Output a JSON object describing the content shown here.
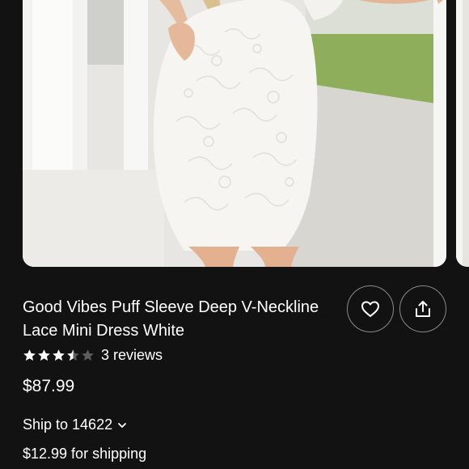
{
  "product": {
    "title": "Good Vibes Puff Sleeve Deep V-Neckline Lace Mini Dress White",
    "rating": 3.5,
    "rating_max": 5,
    "reviews_label": "3 reviews",
    "price": "$87.99"
  },
  "shipping": {
    "ship_to_label": "Ship to 14622",
    "cost_label": "$12.99 for shipping"
  },
  "icons": {
    "like": "heart-icon",
    "share": "share-icon",
    "ship_to_toggle": "chevron-down-icon"
  },
  "colors": {
    "background": "#121212",
    "text": "#ffffff",
    "star_filled": "#ffffff",
    "star_empty": "#5c5c5c",
    "button_border": "#8a8a8a"
  }
}
